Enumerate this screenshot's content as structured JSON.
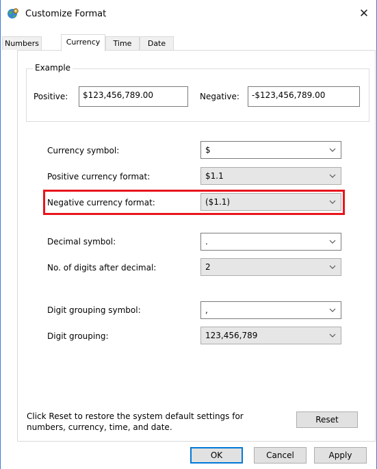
{
  "window": {
    "title": "Customize Format",
    "close_glyph": "✕",
    "icon": "globe-cog-icon"
  },
  "tabs": [
    {
      "label": "Numbers"
    },
    {
      "label": "Currency",
      "active": true
    },
    {
      "label": "Time"
    },
    {
      "label": "Date"
    }
  ],
  "example": {
    "legend": "Example",
    "positive_label": "Positive:",
    "positive_value": "$123,456,789.00",
    "negative_label": "Negative:",
    "negative_value": "-$123,456,789.00"
  },
  "settings": {
    "currency_symbol": {
      "label": "Currency symbol:",
      "value": "$"
    },
    "positive_format": {
      "label": "Positive currency format:",
      "value": "$1.1"
    },
    "negative_format": {
      "label": "Negative currency format:",
      "value": "($1.1)"
    },
    "decimal_symbol": {
      "label": "Decimal symbol:",
      "value": "."
    },
    "digits_after_decimal": {
      "label": "No. of digits after decimal:",
      "value": "2"
    },
    "digit_grouping_symbol": {
      "label": "Digit grouping symbol:",
      "value": ","
    },
    "digit_grouping": {
      "label": "Digit grouping:",
      "value": "123,456,789"
    }
  },
  "footer": {
    "note": "Click Reset to restore the system default settings for numbers, currency, time, and date.",
    "reset_label": "Reset"
  },
  "buttons": {
    "ok": "OK",
    "cancel": "Cancel",
    "apply": "Apply"
  },
  "colors": {
    "highlight": "#e8141c",
    "accent": "#0078d7"
  }
}
